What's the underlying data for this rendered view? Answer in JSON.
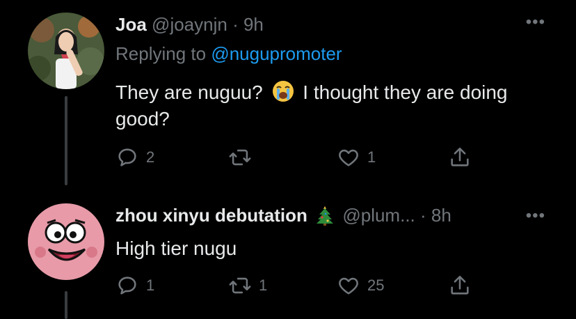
{
  "tweets": [
    {
      "display_name": "Joa",
      "handle": "@joaynjn",
      "time": "· 9h",
      "replying_prefix": "Replying to ",
      "replying_handle": "@nugupromoter",
      "text_part1": "They are nuguu?",
      "text_emoji_name": "loudly-crying-face",
      "text_part2": "I thought they are doing good?",
      "reply_count": "2",
      "retweet_count": "",
      "like_count": "1"
    },
    {
      "display_name": "zhou xinyu debutation",
      "name_emoji_name": "christmas-tree",
      "handle": "@plum...",
      "time": "· 8h",
      "text": "High tier nugu",
      "reply_count": "1",
      "retweet_count": "1",
      "like_count": "25"
    }
  ],
  "more_label": "•••",
  "colors": {
    "background": "#000000",
    "text": "#e7e9ea",
    "muted": "#71767b",
    "link": "#1d9bf0"
  }
}
